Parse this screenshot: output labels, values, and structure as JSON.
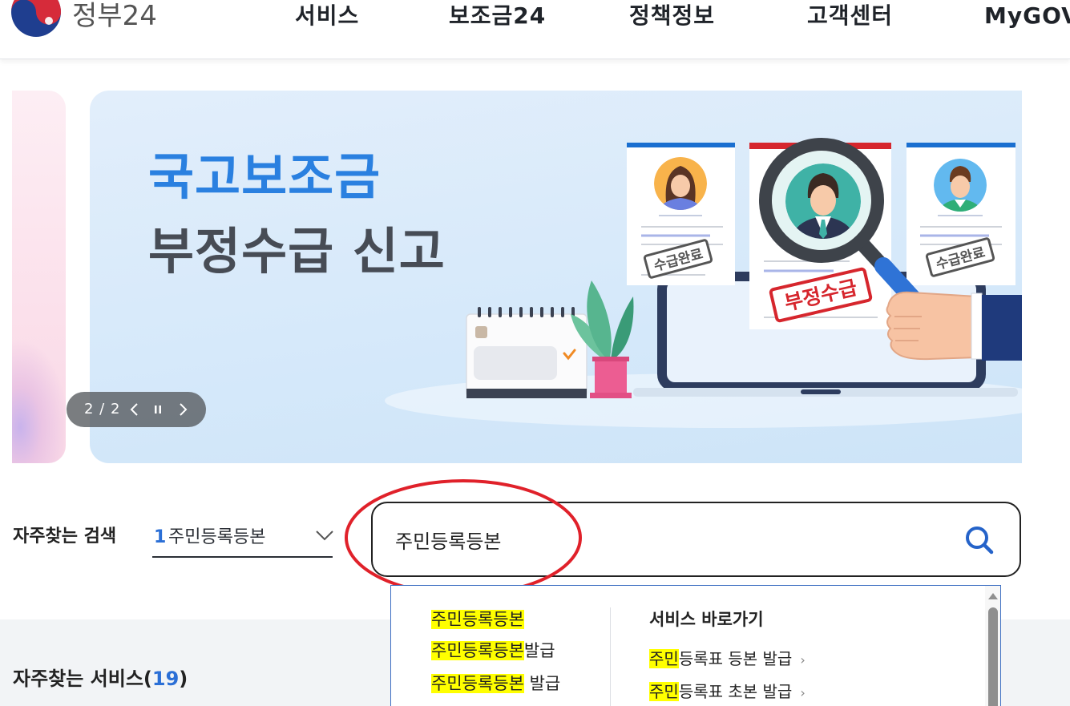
{
  "header": {
    "logo_text": "정부24",
    "nav": [
      "서비스",
      "보조금24",
      "정책정보",
      "고객센터",
      "MyGOV"
    ]
  },
  "banner": {
    "title_line1": "국고보조금",
    "title_line2": "부정수급 신고",
    "stamp_left": "수급완료",
    "stamp_center": "부정수급",
    "stamp_right": "수급완료",
    "slider_counter": "2 / 2"
  },
  "popular_search": {
    "label": "자주찾는 검색",
    "rank": "1",
    "term": "주민등록등본"
  },
  "search": {
    "value": "주민등록등본"
  },
  "autocomplete": {
    "suggestions": [
      {
        "match": "주민등록등본",
        "rest": ""
      },
      {
        "match": "주민등록등본",
        "rest": "발급"
      },
      {
        "match": "주민등록등본",
        "rest": " 발급"
      }
    ],
    "shortcuts_heading": "서비스 바로가기",
    "shortcuts": [
      {
        "match": "주민",
        "rest": "등록표 등본 발급"
      },
      {
        "match": "주민",
        "rest": "등록표 초본 발급"
      }
    ]
  },
  "frequent_services": {
    "label": "자주찾는 서비스(",
    "count": "19",
    "suffix": ")"
  },
  "colors": {
    "accent_blue": "#2a80e0",
    "highlight": "#ffff00",
    "annotation_red": "#e0212a",
    "stamp_red": "#d6262d"
  },
  "icons": {
    "logo": "taegeuk-logo-icon",
    "search": "search-icon",
    "dropdown": "chevron-down-icon",
    "slider_prev": "chevron-left-icon",
    "slider_pause": "pause-icon",
    "slider_next": "chevron-right-icon",
    "shortcut_arrow": "chevron-right-icon"
  }
}
